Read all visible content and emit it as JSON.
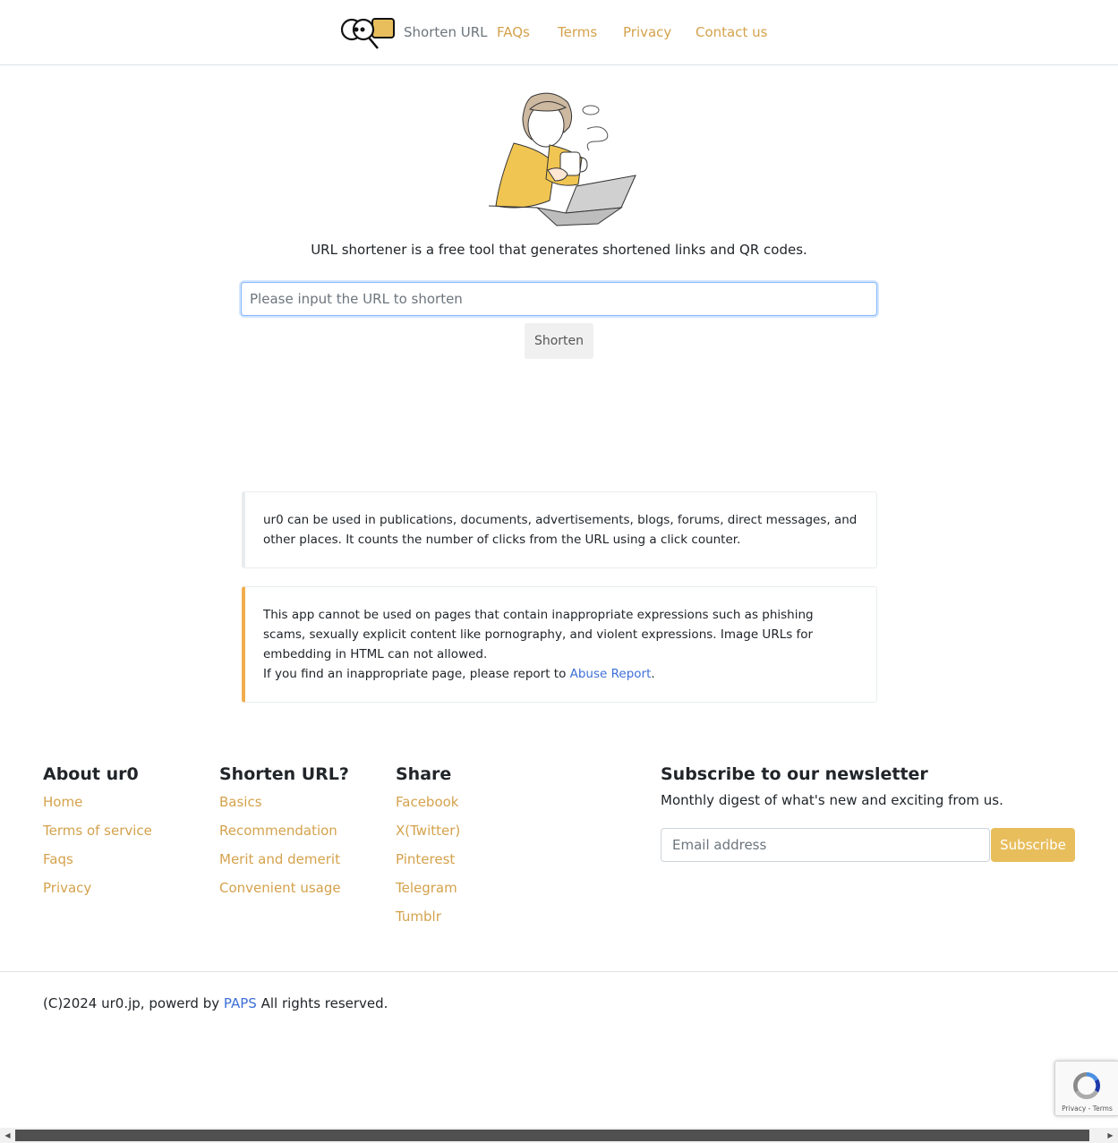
{
  "nav": {
    "brand": "Shorten URL",
    "links": [
      "FAQs",
      "Terms",
      "Privacy",
      "Contact us"
    ]
  },
  "hero": {
    "tagline": "URL shortener is a free tool that generates shortened links and QR codes."
  },
  "form": {
    "url_placeholder": "Please input the URL to shorten",
    "shorten_label": "Shorten"
  },
  "cards": {
    "info_text": "ur0 can be used in publications, documents, advertisements, blogs, forums, direct messages, and other places. It counts the number of clicks from the URL using a click counter.",
    "warn_text": "This app cannot be used on pages that contain inappropriate expressions such as phishing scams, sexually explicit content like pornography, and violent expressions. Image URLs for embedding in HTML can not allowed.",
    "report_prefix": "If you find an inappropriate page, please report to ",
    "report_link": "Abuse Report",
    "report_suffix": "."
  },
  "footer": {
    "col1": {
      "heading": "About ur0",
      "links": [
        "Home",
        "Terms of service",
        "Faqs",
        "Privacy"
      ]
    },
    "col2": {
      "heading": "Shorten URL?",
      "links": [
        "Basics",
        "Recommendation",
        "Merit and demerit",
        "Convenient usage"
      ]
    },
    "col3": {
      "heading": "Share",
      "links": [
        "Facebook",
        "X(Twitter)",
        "Pinterest",
        "Telegram",
        "Tumblr"
      ]
    },
    "newsletter": {
      "heading": "Subscribe to our newsletter",
      "description": "Monthly digest of what's new and exciting from us.",
      "email_placeholder": "Email address",
      "subscribe_label": "Subscribe"
    },
    "copyright_prefix": "(C)2024 ur0.jp, powerd by ",
    "copyright_link": "PAPS",
    "copyright_suffix": " All rights reserved."
  },
  "recaptcha": {
    "text": "Privacy - Terms"
  },
  "colors": {
    "accent": "#d4a24c",
    "button": "#e8be5c",
    "warning": "#f0ad4e",
    "link": "#3d6fd8"
  }
}
